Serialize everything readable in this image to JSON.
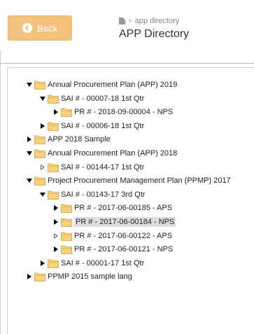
{
  "header": {
    "back_label": "Back",
    "breadcrumb": "app directory",
    "title": "APP Directory"
  },
  "colors": {
    "back_button": "#f4c27d",
    "folder": "#f6d27a",
    "selection": "#dedede"
  },
  "tree": [
    {
      "label": "Annual Procurement Plan (APP) 2019",
      "level": 0,
      "toggle": "expanded"
    },
    {
      "label": "SAI # - 00007-18 1st Qtr",
      "level": 1,
      "toggle": "expanded"
    },
    {
      "label": "PR # - 2018-09-00004 - NPS",
      "level": 2,
      "toggle": "collapsed"
    },
    {
      "label": "SAI # - 00006-18 1st Qtr",
      "level": 1,
      "toggle": "collapsed"
    },
    {
      "label": "APP 2018 Sample",
      "level": 0,
      "toggle": "collapsed"
    },
    {
      "label": "Annual Procurement Plan (APP) 2018",
      "level": 0,
      "toggle": "expanded"
    },
    {
      "label": "SAI # - 00144-17 1st Qtr",
      "level": 1,
      "toggle": "collapsed-outline"
    },
    {
      "label": "Project Procurement Management Plan (PPMP) 2017",
      "level": 0,
      "toggle": "expanded"
    },
    {
      "label": "SAI # - 00143-17 3rd Qtr",
      "level": 1,
      "toggle": "expanded"
    },
    {
      "label": "PR # - 2017-06-00185 - APS",
      "level": 2,
      "toggle": "collapsed"
    },
    {
      "label": "PR # - 2017-06-00184 - NPS",
      "level": 2,
      "toggle": "collapsed",
      "selected": true
    },
    {
      "label": "PR # - 2017-06-00122 - APS",
      "level": 2,
      "toggle": "collapsed-outline"
    },
    {
      "label": "PR # - 2017-06-00121 - NPS",
      "level": 2,
      "toggle": "collapsed"
    },
    {
      "label": "SAI # - 00001-17 1st Qtr",
      "level": 1,
      "toggle": "collapsed"
    },
    {
      "label": "PPMP 2015 sample lang",
      "level": 0,
      "toggle": "collapsed"
    }
  ]
}
